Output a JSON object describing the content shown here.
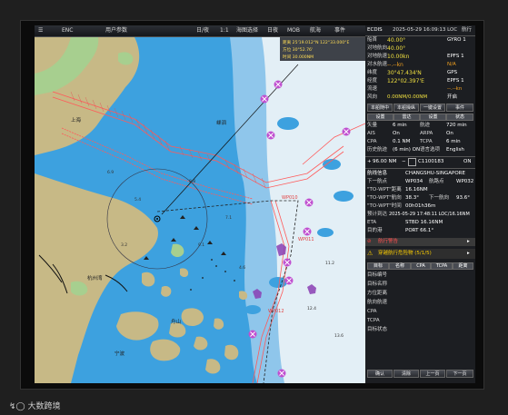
{
  "toolbar": {
    "items": [
      "ENC",
      "用户参数",
      "日/夜",
      "1:1",
      "海图选择",
      "日夜",
      "MOB",
      "航海",
      "事件"
    ]
  },
  "map": {
    "cursor_readout": {
      "line1": "距离 25'19.012°N 122°33.000°E",
      "line2": "方位 30°52.76'",
      "line3": "时间 30.000NM"
    },
    "place_labels": [
      "杭州湾",
      "嵊泗",
      "舟山",
      "宁波",
      "上海"
    ],
    "waypoint_labels": [
      "WP010",
      "WP011",
      "WP012"
    ],
    "depth_labels": [
      "6.9",
      "8.8",
      "5.4",
      "7.1",
      "9.1",
      "3.2",
      "4.6",
      "12.4",
      "11.2",
      "13.6"
    ],
    "colors": {
      "land": "#c7b986",
      "shallow": "#3da1df",
      "medium": "#8fc6eb",
      "deep": "#e3eff6",
      "route": "#ff5a5a",
      "danger": "#a040c0"
    }
  },
  "panel": {
    "title": "ECDIS",
    "datetime": "2025-05-29 16:09:13 LOC",
    "status": "航行",
    "nav": [
      {
        "label": "船首",
        "value": "40.00°",
        "src": "GYRO 1"
      },
      {
        "label": "对地航向",
        "value": "40.00°",
        "src": ""
      },
      {
        "label": "对地航速",
        "value": "10.00kn",
        "src": "EPFS 1"
      },
      {
        "label": "对水航速",
        "value": "--.--kn",
        "src": "N/A"
      },
      {
        "label": "纬度",
        "value": "30°47.434'N",
        "src": "GPS"
      },
      {
        "label": "经度",
        "value": "122°02.397'E",
        "src": "EPFS 1"
      },
      {
        "label": "流速",
        "value": "--.--kn",
        "src": ""
      },
      {
        "label": "风向",
        "value": "0.00NM/0.00NM",
        "src": "开启"
      }
    ],
    "buttons_row1": [
      "本船随中",
      "本船操纵",
      "一键设置",
      "事件"
    ],
    "settings_head": [
      "设置",
      "雷达",
      "设置",
      "状态"
    ],
    "settings": [
      {
        "a": "矢量",
        "b": "6 min",
        "c": "航迹",
        "d": "720 min"
      },
      {
        "a": "AIS",
        "b": "On",
        "c": "ARPA",
        "d": "On"
      },
      {
        "a": "CPA",
        "b": "0.1 NM",
        "c": "TCPA",
        "d": "6 min"
      },
      {
        "a": "历史航迹",
        "b": "(6 min) ON",
        "c": "语言选项",
        "d": "English"
      }
    ],
    "scale": {
      "range": "96.00 NM",
      "ratio": "C1100183",
      "mode": "ON"
    },
    "route_title": "航线信息",
    "route_name": "CHANGSHU-SINGAPORE",
    "route": [
      {
        "k": "下一航点",
        "v": "WP034",
        "k2": "航路点",
        "v2": "WP032"
      },
      {
        "k": "\"TO-WPT\"距离",
        "v": "16.16NM",
        "k2": "",
        "v2": ""
      },
      {
        "k": "\"TO-WPT\"航向",
        "v": "38.3°",
        "k2": "下一航向",
        "v2": "93.6°"
      },
      {
        "k": "\"TO-WPT\"时间",
        "v": "00h01h36m",
        "k2": "",
        "v2": ""
      },
      {
        "k": "预计到达",
        "v": "2025-05-29 17:48:11 LOC/16.16NM",
        "k2": "",
        "v2": ""
      },
      {
        "k": "ETA",
        "v": "STBD 16.16NM",
        "k2": "",
        "v2": ""
      },
      {
        "k": "目的港",
        "v": "PORT 66.1°",
        "k2": "",
        "v2": ""
      }
    ],
    "alarm1": "航行警告",
    "alarm2": "穿越航行危险物 (5/1/5)",
    "targets_head": [
      "目标",
      "名称",
      "CPA",
      "TCPA",
      "距离"
    ],
    "targets_rows": [
      "目标编号",
      "目标名称",
      "方位距离",
      "航向航速",
      "CPA",
      "TCPA",
      "目标状态"
    ],
    "bottom_buttons": [
      "确认",
      "清除",
      "上一页",
      "下一页"
    ]
  },
  "watermark": "大数跨境"
}
